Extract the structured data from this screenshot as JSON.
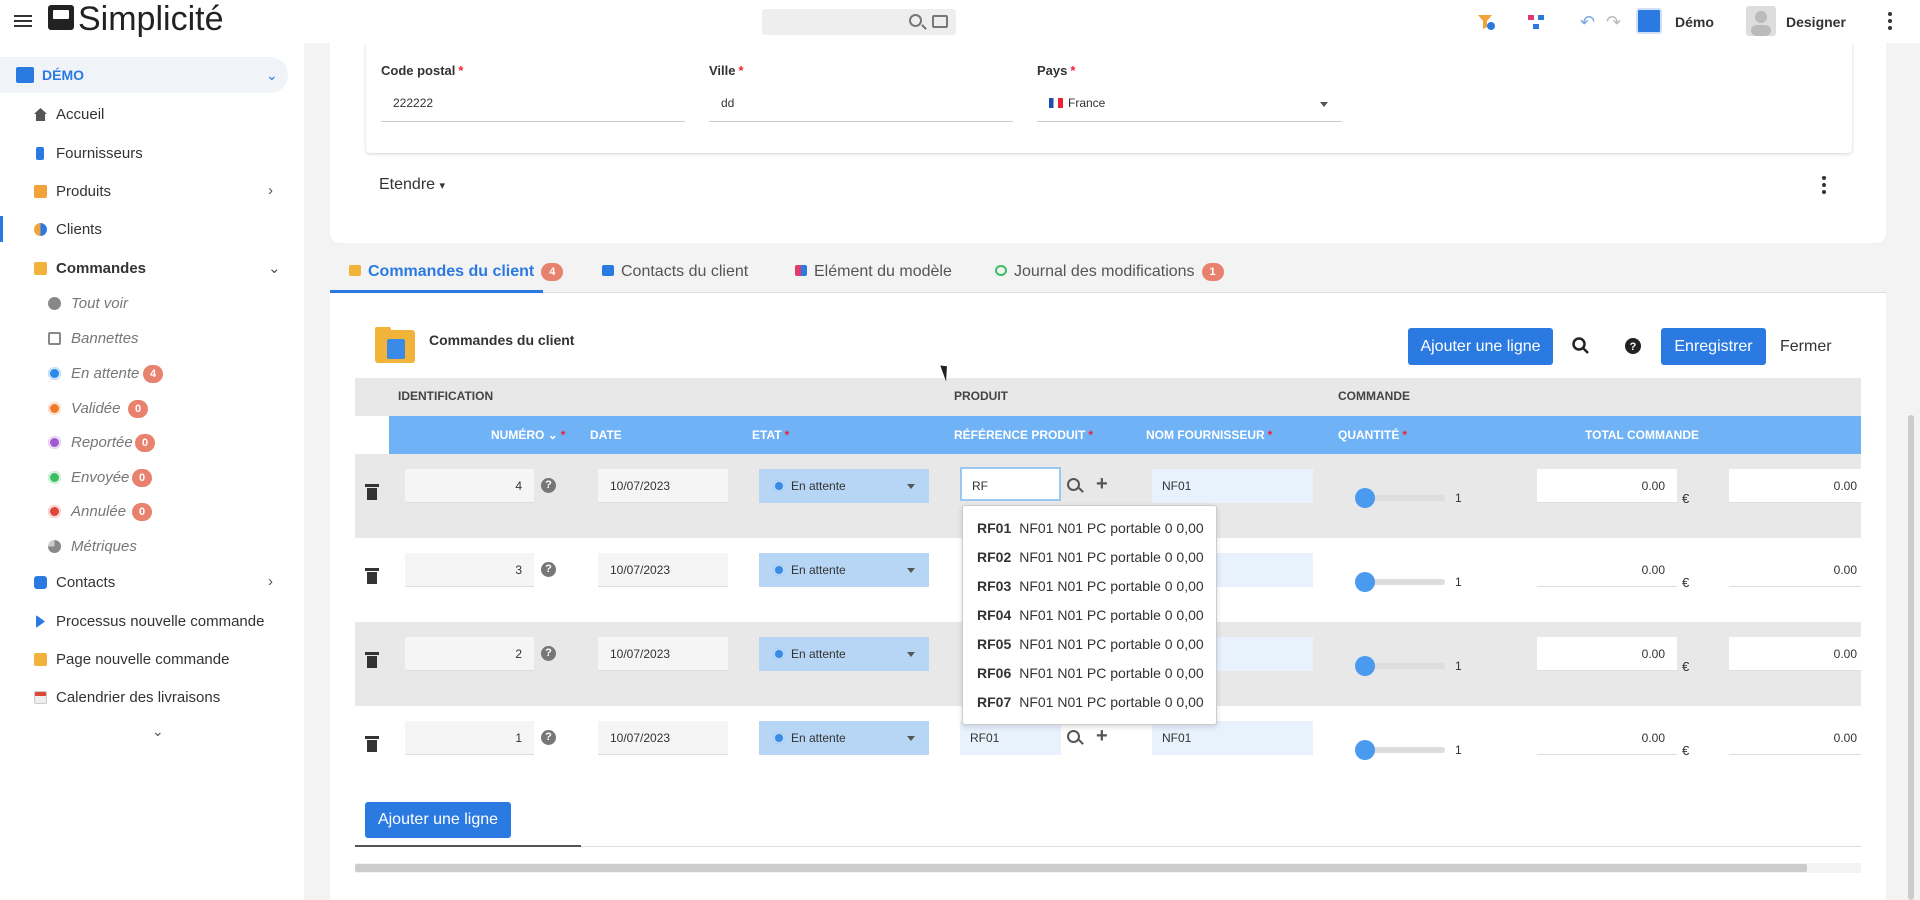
{
  "app": {
    "name": "Simplicité"
  },
  "topbar": {
    "scope_label": "Démo",
    "user_label": "Designer"
  },
  "sidebar": {
    "group_label": "DÉMO",
    "items": [
      {
        "label": "Accueil",
        "color": "#555"
      },
      {
        "label": "Fournisseurs",
        "color": "#2a7ae2"
      },
      {
        "label": "Produits",
        "color": "#f2a23a"
      },
      {
        "label": "Clients",
        "color": "#2a7ae2"
      },
      {
        "label": "Commandes",
        "color": "#f2b33a"
      }
    ],
    "sub_items": [
      {
        "label": "Tout voir",
        "color": "#888",
        "badge": ""
      },
      {
        "label": "Bannettes",
        "color": "#888",
        "badge": ""
      },
      {
        "label": "En attente",
        "color": "#2a8ae8",
        "badge": "4"
      },
      {
        "label": "Validée",
        "color": "#f07a2a",
        "badge": "0"
      },
      {
        "label": "Reportée",
        "color": "#a25ad0",
        "badge": "0"
      },
      {
        "label": "Envoyée",
        "color": "#3ac060",
        "badge": "0"
      },
      {
        "label": "Annulée",
        "color": "#e0453a",
        "badge": "0"
      },
      {
        "label": "Métriques",
        "color": "#888",
        "badge": ""
      }
    ],
    "bottom_items": [
      {
        "label": "Contacts"
      },
      {
        "label": "Processus nouvelle commande"
      },
      {
        "label": "Page nouvelle commande"
      },
      {
        "label": "Calendrier des livraisons"
      }
    ]
  },
  "form": {
    "postal_label": "Code postal",
    "postal_value": "222222",
    "city_label": "Ville",
    "city_value": "dd",
    "country_label": "Pays",
    "country_value": "France",
    "extend_label": "Etendre"
  },
  "tabs": [
    {
      "label": "Commandes du client",
      "badge": "4"
    },
    {
      "label": "Contacts du client",
      "badge": ""
    },
    {
      "label": "Elément du modèle",
      "badge": ""
    },
    {
      "label": "Journal des modifications",
      "badge": "1"
    }
  ],
  "list": {
    "title": "Commandes du client",
    "add_label": "Ajouter une ligne",
    "save_label": "Enregistrer",
    "close_label": "Fermer",
    "groups": {
      "identification": "IDENTIFICATION",
      "produit": "PRODUIT",
      "commande": "COMMANDE"
    },
    "columns": {
      "numero": "NUMÉRO",
      "date": "DATE",
      "etat": "ETAT",
      "ref": "RÉFÉRENCE PRODUIT",
      "fournisseur": "NOM FOURNISSEUR",
      "quantite": "QUANTITÉ",
      "total": "TOTAL COMMANDE"
    },
    "rows": [
      {
        "numero": "4",
        "date": "10/07/2023",
        "etat": "En attente",
        "ref": "RF",
        "fournisseur": "NF01",
        "quantite": "1",
        "total": "0.00",
        "extra": "0.00",
        "currency": "€"
      },
      {
        "numero": "3",
        "date": "10/07/2023",
        "etat": "En attente",
        "ref": "",
        "fournisseur": "",
        "quantite": "1",
        "total": "0.00",
        "extra": "0.00",
        "currency": "€"
      },
      {
        "numero": "2",
        "date": "10/07/2023",
        "etat": "En attente",
        "ref": "",
        "fournisseur": "",
        "quantite": "1",
        "total": "0.00",
        "extra": "0.00",
        "currency": "€"
      },
      {
        "numero": "1",
        "date": "10/07/2023",
        "etat": "En attente",
        "ref": "RF01",
        "fournisseur": "NF01",
        "quantite": "1",
        "total": "0.00",
        "extra": "0.00",
        "currency": "€"
      }
    ]
  },
  "autocomplete": [
    {
      "code": "RF01",
      "desc": "NF01 N01 PC portable 0 0,00"
    },
    {
      "code": "RF02",
      "desc": "NF01 N01 PC portable 0 0,00"
    },
    {
      "code": "RF03",
      "desc": "NF01 N01 PC portable 0 0,00"
    },
    {
      "code": "RF04",
      "desc": "NF01 N01 PC portable 0 0,00"
    },
    {
      "code": "RF05",
      "desc": "NF01 N01 PC portable 0 0,00"
    },
    {
      "code": "RF06",
      "desc": "NF01 N01 PC portable 0 0,00"
    },
    {
      "code": "RF07",
      "desc": "NF01 N01 PC portable 0 0,00"
    }
  ],
  "colors": {
    "accent": "#2a7ae2",
    "header": "#6fb2f5",
    "badge": "#e8826e"
  }
}
